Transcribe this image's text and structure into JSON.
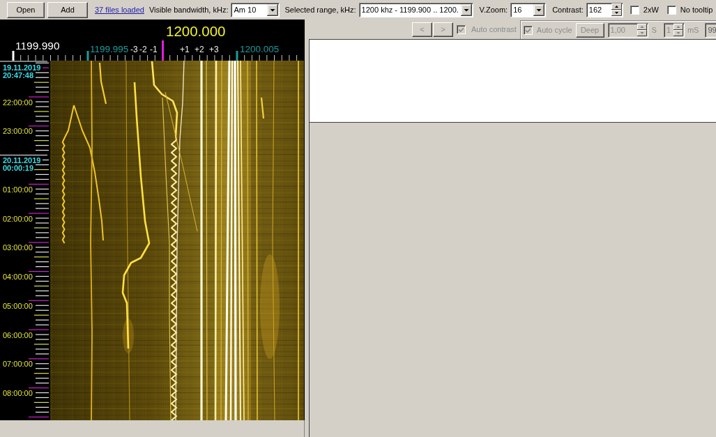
{
  "toolbar": {
    "buttons": [
      {
        "label": "Open"
      },
      {
        "label": "Add"
      }
    ],
    "files_link": "37 files loaded",
    "fields": [
      {
        "kind": "select",
        "label": "Visible bandwidth, kHz:",
        "value": "Am 10"
      },
      {
        "kind": "select",
        "label": "Selected range, kHz:",
        "value": "1200 khz - 1199.900 .. 1200."
      },
      {
        "kind": "select",
        "label": "V.Zoom:",
        "value": "16"
      },
      {
        "kind": "spinner",
        "label": "Contrast:",
        "value": "162"
      }
    ],
    "checkboxes": [
      {
        "label": "2xW",
        "checked": false
      },
      {
        "label": "No tooltip",
        "checked": false
      }
    ]
  },
  "frequency_scale": {
    "center": "1200.000",
    "labels": [
      {
        "text": "1199.990",
        "kind": "edge"
      },
      {
        "text": "1199.995",
        "kind": "marker"
      },
      {
        "text": "1200.005",
        "kind": "marker"
      }
    ],
    "offsets": [
      "-3",
      "-2",
      "-1",
      "+1",
      "+2",
      "+3"
    ]
  },
  "time_axis": [
    {
      "kind": "date",
      "date": "19.11.2019",
      "time": "20:47:48"
    },
    {
      "kind": "hour",
      "time": "22:00:00"
    },
    {
      "kind": "hour",
      "time": "23:00:00"
    },
    {
      "kind": "date",
      "date": "20.11.2019",
      "time": "00:00:19"
    },
    {
      "kind": "hour",
      "time": "01:00:00"
    },
    {
      "kind": "hour",
      "time": "02:00:00"
    },
    {
      "kind": "hour",
      "time": "03:00:00"
    },
    {
      "kind": "hour",
      "time": "04:00:00"
    },
    {
      "kind": "hour",
      "time": "05:00:00"
    },
    {
      "kind": "hour",
      "time": "06:00:00"
    },
    {
      "kind": "hour",
      "time": "07:00:00"
    },
    {
      "kind": "hour",
      "time": "08:00:00"
    }
  ],
  "playback": {
    "nav_buttons": [
      {
        "label": "<",
        "disabled": true
      },
      {
        "label": ">",
        "disabled": true
      }
    ],
    "auto_contrast": {
      "label": "Auto contrast",
      "checked": true,
      "disabled": true
    },
    "cycle": {
      "auto_cycle": {
        "label": "Auto cycle",
        "checked": true,
        "disabled": true
      },
      "deep_button": {
        "label": "Deep",
        "disabled": true
      },
      "spinners": [
        {
          "value": "1,00",
          "unit": "S",
          "disabled": true
        },
        {
          "value": "1",
          "unit": "mS",
          "disabled": true
        }
      ],
      "field_3": {
        "value": "99",
        "disabled": true
      }
    }
  }
}
